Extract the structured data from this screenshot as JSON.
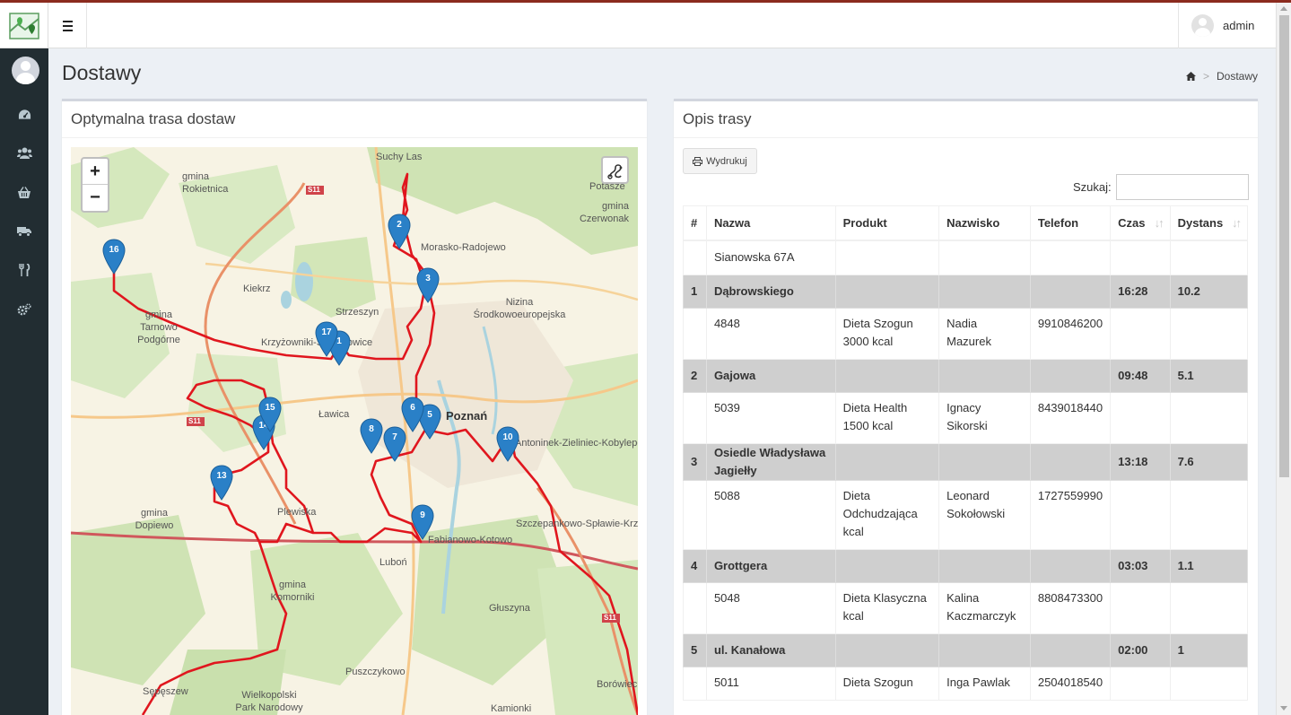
{
  "header": {
    "user_name": "admin"
  },
  "page": {
    "title": "Dostawy"
  },
  "breadcrumb": {
    "current": "Dostawy"
  },
  "map_box": {
    "title": "Optymalna trasa dostaw"
  },
  "map": {
    "zoom_in": "+",
    "zoom_out": "−",
    "labels": [
      "gmina Rokietnica",
      "Suchy Las",
      "Potasze",
      "gmina Czerwonak",
      "Morasko-Radojewo",
      "Kiekrz",
      "Strzeszyn",
      "Nizina Środkowoeuropejska",
      "gmina Tarnowo Podgórne",
      "Krzyżowniki-Smochowice",
      "Ławica",
      "Poznań",
      "Antoninek-Zieliniec-Kobylepole",
      "gmina Dopiewo",
      "Plewiska",
      "Szczepankowo-Spławie-Krzesiny",
      "Luboń",
      "Fabianowo-Kotowo",
      "Głuszyna",
      "gmina Komorniki",
      "Puszczykowo",
      "Sępęszew",
      "Wielkopolski Park Narodowy",
      "Kamionki",
      "Borówiec",
      "S11",
      "S11",
      "S11"
    ],
    "markers": [
      "1",
      "2",
      "3",
      "5",
      "6",
      "7",
      "8",
      "9",
      "10",
      "13",
      "14",
      "15",
      "16",
      "17"
    ]
  },
  "desc_box": {
    "title": "Opis trasy"
  },
  "toolbar": {
    "print_label": "Wydrukuj",
    "search_label": "Szukaj:",
    "search_value": ""
  },
  "table": {
    "columns": [
      "#",
      "Nazwa",
      "Produkt",
      "Nazwisko",
      "Telefon",
      "Czas",
      "Dystans"
    ],
    "start_row": {
      "name": "Sianowska 67A"
    },
    "stops": [
      {
        "num": "1",
        "street": "Dąbrowskiego",
        "time": "16:28",
        "distance": "10.2",
        "house": "4848",
        "product": "Dieta Szogun 3000 kcal",
        "person": "Nadia Mazurek",
        "phone": "9910846200"
      },
      {
        "num": "2",
        "street": "Gajowa",
        "time": "09:48",
        "distance": "5.1",
        "house": "5039",
        "product": "Dieta Health 1500 kcal",
        "person": "Ignacy Sikorski",
        "phone": "8439018440"
      },
      {
        "num": "3",
        "street": "Osiedle Władysława Jagiełły",
        "time": "13:18",
        "distance": "7.6",
        "house": "5088",
        "product": "Dieta Odchudzająca kcal",
        "person": "Leonard Sokołowski",
        "phone": "1727559990"
      },
      {
        "num": "4",
        "street": "Grottgera",
        "time": "03:03",
        "distance": "1.1",
        "house": "5048",
        "product": "Dieta Klasyczna kcal",
        "person": "Kalina Kaczmarczyk",
        "phone": "8808473300"
      },
      {
        "num": "5",
        "street": "ul. Kanałowa",
        "time": "02:00",
        "distance": "1",
        "house": "5011",
        "product": "Dieta Szogun",
        "person": "Inga Pawlak",
        "phone": "2504018540"
      }
    ]
  },
  "colors": {
    "sidebar_bg": "#222d32",
    "marker": "#2a80c7",
    "route": "#e0161e",
    "row_highlight": "#cfcfcf"
  }
}
